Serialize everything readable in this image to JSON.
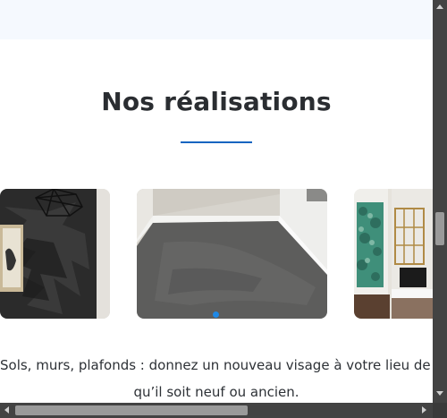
{
  "section": {
    "title": "Nos réalisations",
    "description_line1": "Sols, murs, plafonds : donnez un nouveau visage à votre lieu de vie",
    "description_line2": "qu’il soit neuf ou ancien."
  },
  "carousel": {
    "slide_count_visible": 3,
    "active_dot_color": "#1e88e5"
  },
  "colors": {
    "accent": "#1565c0",
    "top_band": "#f5f9fe",
    "heading": "#2a2d31"
  }
}
